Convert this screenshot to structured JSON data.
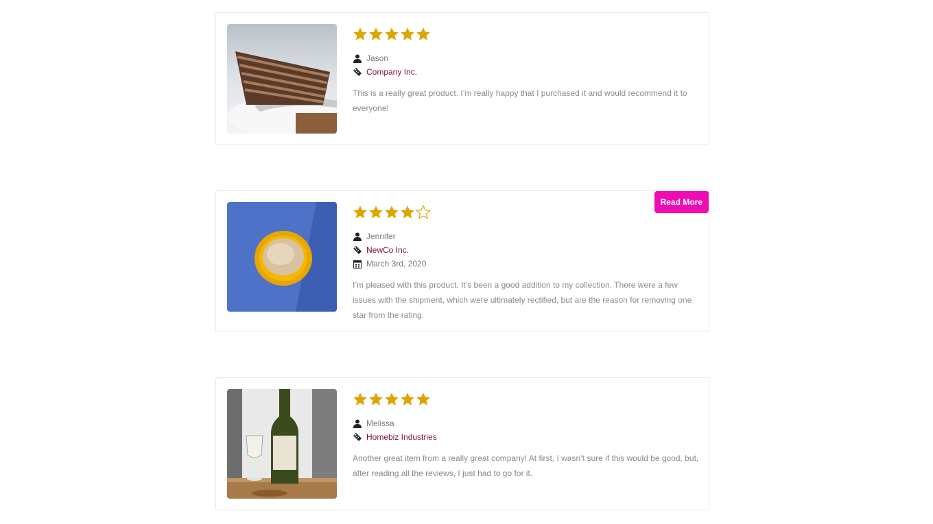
{
  "reviews": [
    {
      "rating": 5,
      "max_rating": 5,
      "image": "chocolate-cake-photo",
      "author": "Jason",
      "company": "Company Inc.",
      "date": "",
      "text": "This is a really great product. I’m really happy that I purchased it and would recommend it to everyone!",
      "read_more": ""
    },
    {
      "rating": 4,
      "max_rating": 5,
      "image": "ice-cream-bowl-photo",
      "author": "Jennifer",
      "company": "NewCo Inc.",
      "date": "March 3rd, 2020",
      "text": "I’m pleased with this product. It’s been a good addition to my collection. There were a few issues with the shipment, which were ultimately rectified, but are the reason for removing one star from the rating.",
      "read_more": "Read More"
    },
    {
      "rating": 5,
      "max_rating": 5,
      "image": "wine-bottle-photo",
      "author": "Melissa",
      "company": "Homebiz Industries",
      "date": "",
      "text": "Another great item from a really great company! At first, I wasn’t sure if this would be good, but, after reading all the reviews, I just had to go for it.",
      "read_more": ""
    }
  ],
  "colors": {
    "star": "#dba600",
    "company_link": "#7a0f33",
    "read_more_bg": "#f00cb4",
    "text_muted": "#8a8a8a"
  },
  "icons": {
    "author": "user-icon",
    "company": "tag-icon",
    "date": "calendar-icon"
  }
}
